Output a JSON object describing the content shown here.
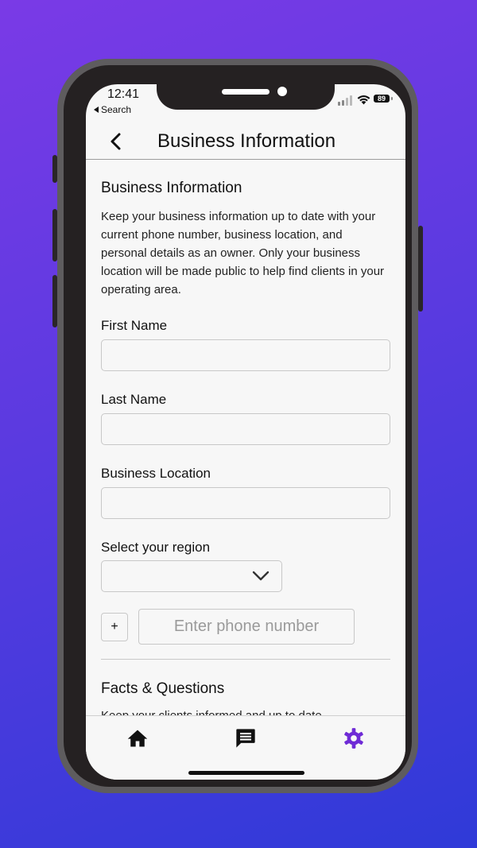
{
  "status_bar": {
    "time": "12:41",
    "back_app": "Search",
    "battery": "89"
  },
  "nav": {
    "title": "Business Information"
  },
  "section": {
    "title": "Business Information",
    "description": "Keep your business information up to date with your current phone number, business location, and personal details as an owner. Only your business location will be made public to help find clients in your operating area."
  },
  "form": {
    "first_name": {
      "label": "First Name",
      "value": ""
    },
    "last_name": {
      "label": "Last Name",
      "value": ""
    },
    "business_location": {
      "label": "Business Location",
      "value": ""
    },
    "region": {
      "label": "Select your region",
      "selected": ""
    },
    "phone": {
      "prefix": "+",
      "placeholder": "Enter phone number"
    }
  },
  "facts": {
    "title": "Facts & Questions",
    "description_partial": "Keep your clients informed and up to date"
  },
  "tabbar": {
    "items": [
      "home-icon",
      "chat-icon",
      "settings-icon"
    ],
    "active": "settings-icon"
  },
  "colors": {
    "accent": "#6f2bd6",
    "background_top": "#7a3ae6",
    "background_bottom": "#2f3ad8"
  }
}
